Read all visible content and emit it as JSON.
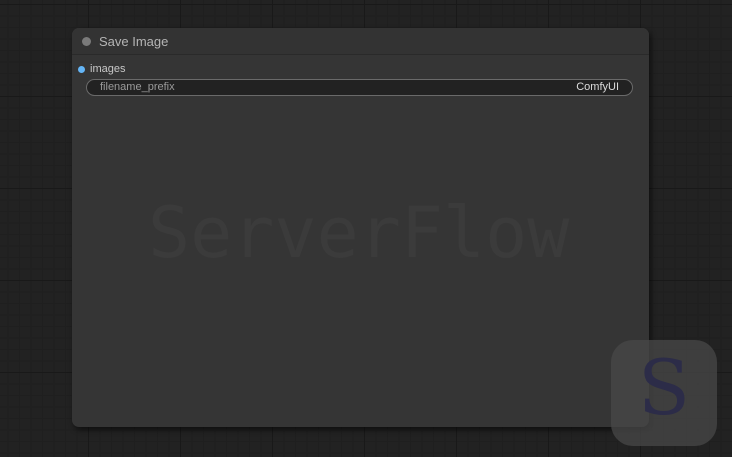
{
  "node": {
    "title": "Save Image",
    "inputs": [
      {
        "label": "images",
        "type_color": "#64b5f6"
      }
    ],
    "widgets": [
      {
        "name": "filename_prefix",
        "value": "ComfyUI"
      }
    ]
  },
  "watermark": {
    "text": "ServerFlow",
    "badge_letter": "S"
  }
}
